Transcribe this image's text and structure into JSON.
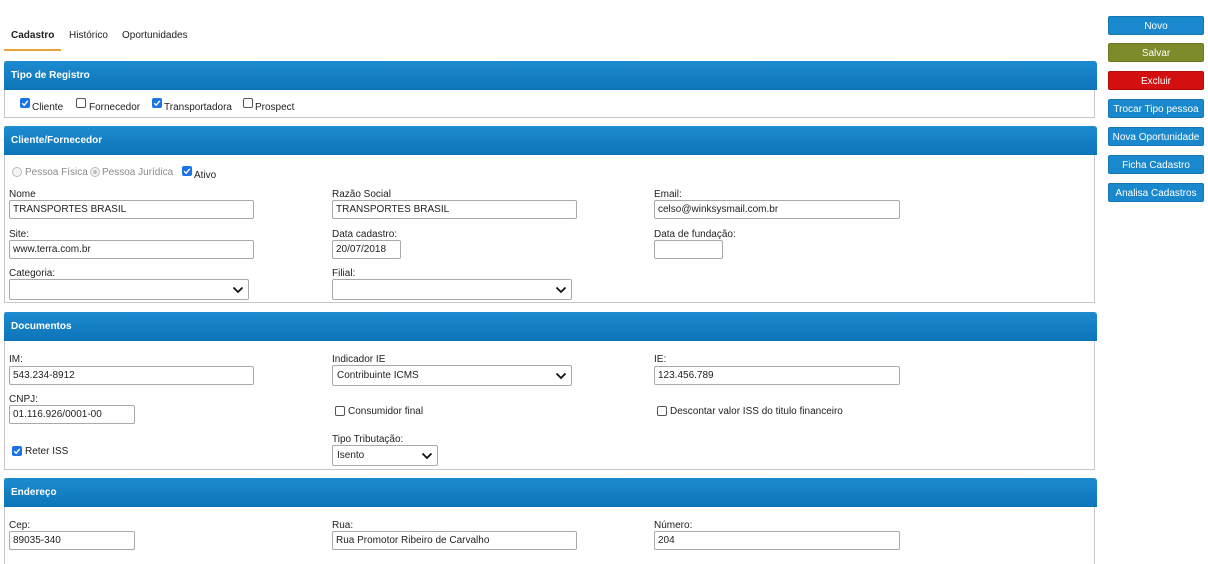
{
  "tabs": [
    {
      "label": "Cadastro"
    },
    {
      "label": "Histórico"
    },
    {
      "label": "Oportunidades"
    }
  ],
  "buttons": {
    "novo": "Novo",
    "salvar": "Salvar",
    "excluir": "Excluir",
    "trocar": "Trocar Tipo pessoa",
    "nova_oportunidade": "Nova Oportunidade",
    "ficha": "Ficha Cadastro",
    "analisa": "Analisa Cadastros"
  },
  "tipo_registro": {
    "title": "Tipo de Registro",
    "cliente": {
      "label": "Cliente",
      "checked": true
    },
    "fornecedor": {
      "label": "Fornecedor",
      "checked": false
    },
    "transportadora": {
      "label": "Transportadora",
      "checked": true
    },
    "prospect": {
      "label": "Prospect",
      "checked": false
    }
  },
  "cliente": {
    "title": "Cliente/Fornecedor",
    "pessoa_fisica": "Pessoa Física",
    "pessoa_juridica": "Pessoa Jurídica",
    "ativo": "Ativo",
    "nome_label": "Nome",
    "nome_value": "TRANSPORTES BRASIL",
    "razao_label": "Razão Social",
    "razao_value": "TRANSPORTES BRASIL",
    "email_label": "Email:",
    "email_value": "celso@winksysmail.com.br",
    "site_label": "Site:",
    "site_value": "www.terra.com.br",
    "data_cadastro_label": "Data cadastro:",
    "data_cadastro_value": "20/07/2018",
    "data_fundacao_label": "Data de fundação:",
    "data_fundacao_value": "",
    "categoria_label": "Categoria:",
    "categoria_value": "",
    "filial_label": "Filial:",
    "filial_value": ""
  },
  "documentos": {
    "title": "Documentos",
    "im_label": "IM:",
    "im_value": "543.234-8912",
    "indicador_label": "Indicador IE",
    "indicador_value": "Contribuinte ICMS",
    "ie_label": "IE:",
    "ie_value": "123.456.789",
    "cnpj_label": "CNPJ:",
    "cnpj_value": "01.116.926/0001-00",
    "consumidor_label": "Consumidor final",
    "descontar_label": "Descontar valor ISS do titulo financeiro",
    "reter_label": "Reter ISS",
    "tipo_trib_label": "Tipo Tributação:",
    "tipo_trib_value": "Isento"
  },
  "endereco": {
    "title": "Endereço",
    "cep_label": "Cep:",
    "cep_value": "89035-340",
    "rua_label": "Rua:",
    "rua_value": "Rua Promotor Ribeiro de Carvalho",
    "numero_label": "Número:",
    "numero_value": "204"
  },
  "colors": {
    "accent": "#1a88cc",
    "save": "#7f8a2a",
    "delete": "#d40f0f",
    "tab_underline": "#e8a33a"
  }
}
